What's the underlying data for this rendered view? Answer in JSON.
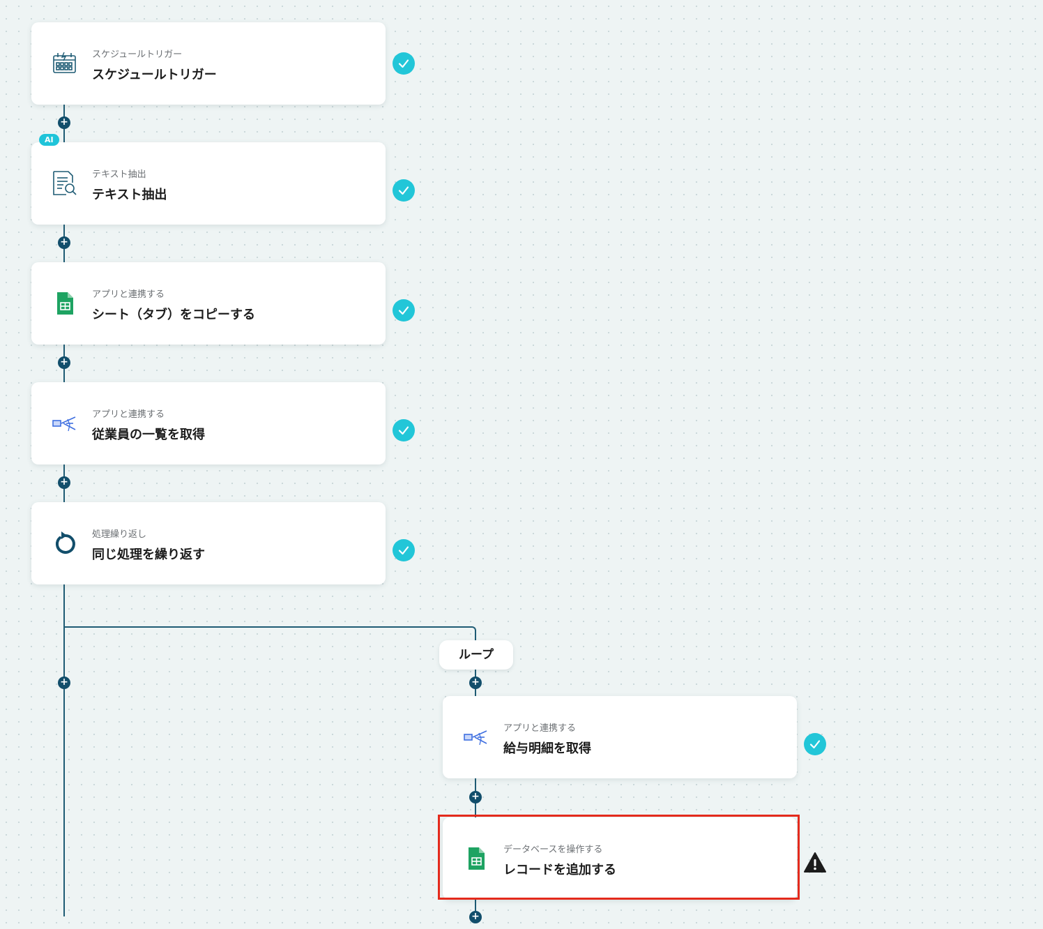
{
  "colors": {
    "connector": "#1e5b74",
    "plus_button": "#124e6b",
    "check": "#22c6d8",
    "highlight": "#e42a1c",
    "warning": "#1c1c1c"
  },
  "steps": [
    {
      "subtitle": "スケジュールトリガー",
      "title": "スケジュールトリガー",
      "icon": "schedule-calendar-icon",
      "status": "complete"
    },
    {
      "subtitle": "テキスト抽出",
      "title": "テキスト抽出",
      "icon": "document-search-icon",
      "badge": "AI",
      "status": "complete"
    },
    {
      "subtitle": "アプリと連携する",
      "title": "シート（タブ）をコピーする",
      "icon": "google-sheets-icon",
      "status": "complete"
    },
    {
      "subtitle": "アプリと連携する",
      "title": "従業員の一覧を取得",
      "icon": "freee-app-icon",
      "status": "complete"
    },
    {
      "subtitle": "処理繰り返し",
      "title": "同じ処理を繰り返す",
      "icon": "repeat-icon",
      "status": "complete"
    }
  ],
  "loop": {
    "label": "ループ",
    "steps": [
      {
        "subtitle": "アプリと連携する",
        "title": "給与明細を取得",
        "icon": "freee-app-icon",
        "status": "complete"
      },
      {
        "subtitle": "データベースを操作する",
        "title": "レコードを追加する",
        "icon": "google-sheets-icon",
        "status": "warning"
      }
    ]
  },
  "add_step_symbol": "+"
}
